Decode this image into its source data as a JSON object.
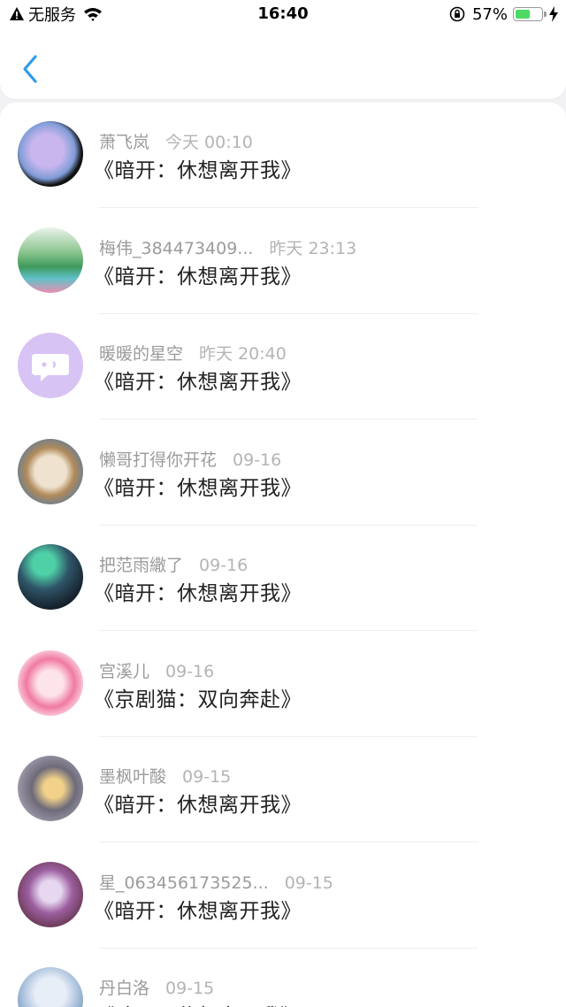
{
  "status_bar": {
    "carrier": "无服务",
    "time": "16:40",
    "battery": "57%",
    "battery_level": 0.57
  },
  "items": [
    {
      "name": "萧飞岚",
      "time": "今天 00:10",
      "title": "《暗开：休想离开我》"
    },
    {
      "name": "梅伟_384473409...",
      "time": "昨天 23:13",
      "title": "《暗开：休想离开我》"
    },
    {
      "name": "暖暖的星空",
      "time": "昨天 20:40",
      "title": "《暗开：休想离开我》"
    },
    {
      "name": "懒哥打得你开花",
      "time": "09-16",
      "title": "《暗开：休想离开我》"
    },
    {
      "name": "把范雨繖了",
      "time": "09-16",
      "title": "《暗开：休想离开我》"
    },
    {
      "name": "宫溪儿",
      "time": "09-16",
      "title": "《京剧猫：双向奔赴》"
    },
    {
      "name": "墨枫叶酸",
      "time": "09-15",
      "title": "《暗开：休想离开我》"
    },
    {
      "name": "星_063456173525...",
      "time": "09-15",
      "title": "《暗开：休想离开我》"
    },
    {
      "name": "丹白洛",
      "time": "09-15",
      "title": "《暗开：休想离开我》"
    }
  ]
}
